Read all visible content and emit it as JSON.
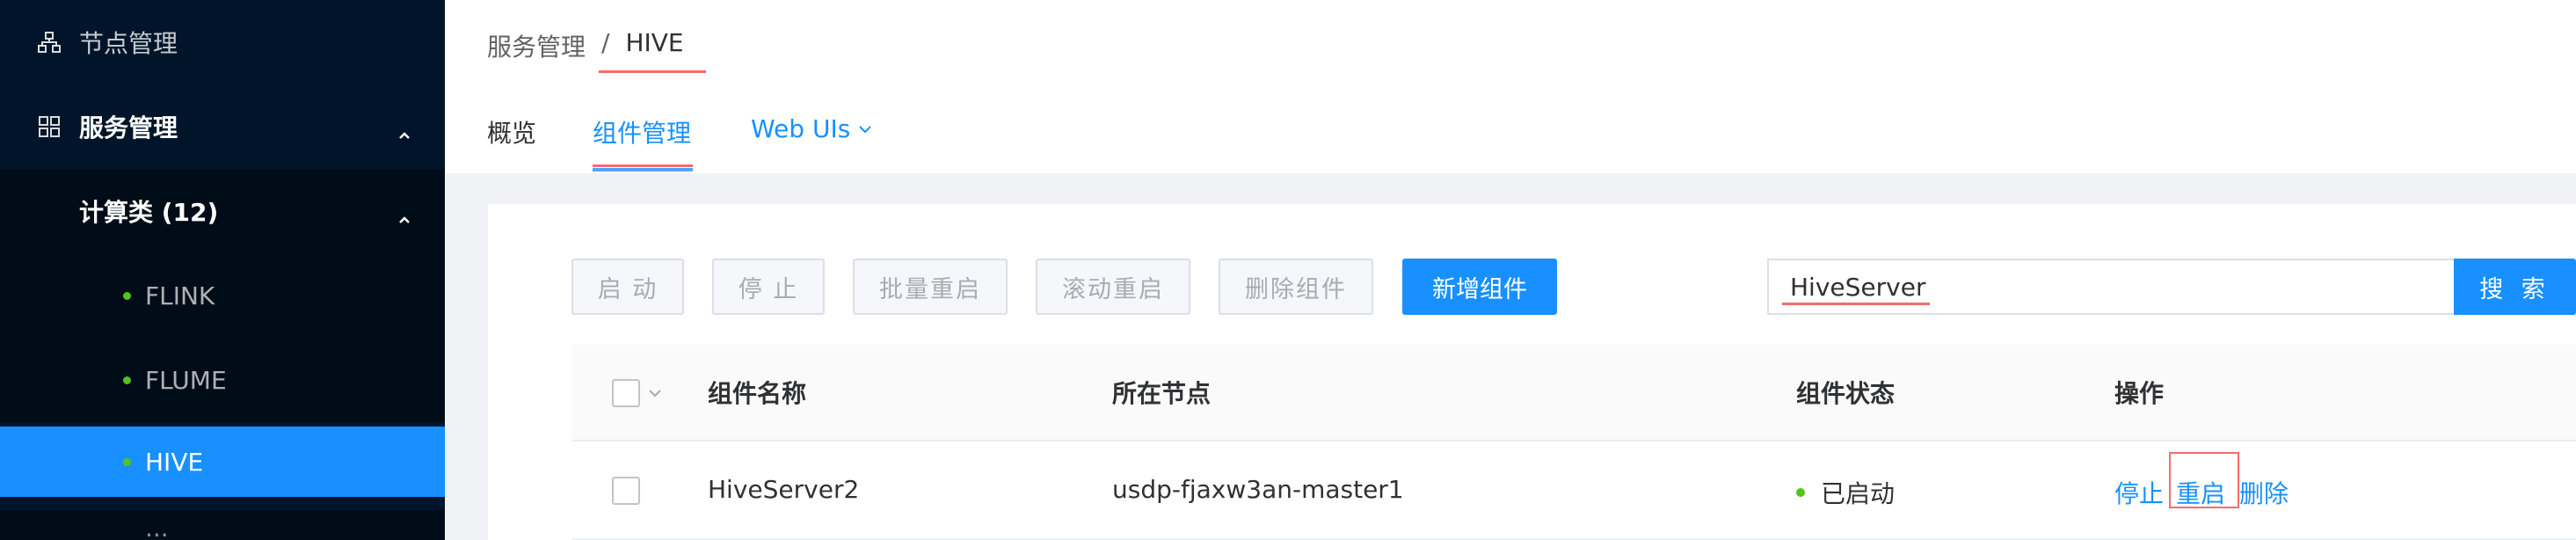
{
  "sidebar": {
    "items": [
      {
        "label": "节点管理",
        "icon": "cluster-icon"
      },
      {
        "label": "服务管理",
        "icon": "grid-icon"
      },
      {
        "label": "计算类 (12)"
      },
      {
        "label": "FLINK"
      },
      {
        "label": "FLUME"
      },
      {
        "label": "HIVE"
      },
      {
        "label": "..."
      }
    ]
  },
  "header": {
    "breadcrumb": [
      "服务管理",
      "HIVE"
    ],
    "separator": "/",
    "tabs": [
      {
        "label": "概览"
      },
      {
        "label": "组件管理"
      },
      {
        "label": "Web UIs"
      }
    ]
  },
  "toolbar": {
    "start_label": "启 动",
    "stop_label": "停 止",
    "batch_restart_label": "批量重启",
    "rolling_restart_label": "滚动重启",
    "delete_label": "删除组件",
    "add_label": "新增组件",
    "search_value": "HiveServer",
    "search_label": "搜 索"
  },
  "table": {
    "columns": [
      "组件名称",
      "所在节点",
      "组件状态",
      "操作"
    ],
    "rows": [
      {
        "name": "HiveServer2",
        "node": "usdp-fjaxw3an-master1",
        "state": "已启动",
        "ops": [
          "停止",
          "重启",
          "删除"
        ]
      }
    ]
  },
  "colors": {
    "primary": "#1890ff",
    "sidebar_bg": "#001529",
    "status_green": "#52c41a",
    "highlight_red": "#f56c6c"
  }
}
